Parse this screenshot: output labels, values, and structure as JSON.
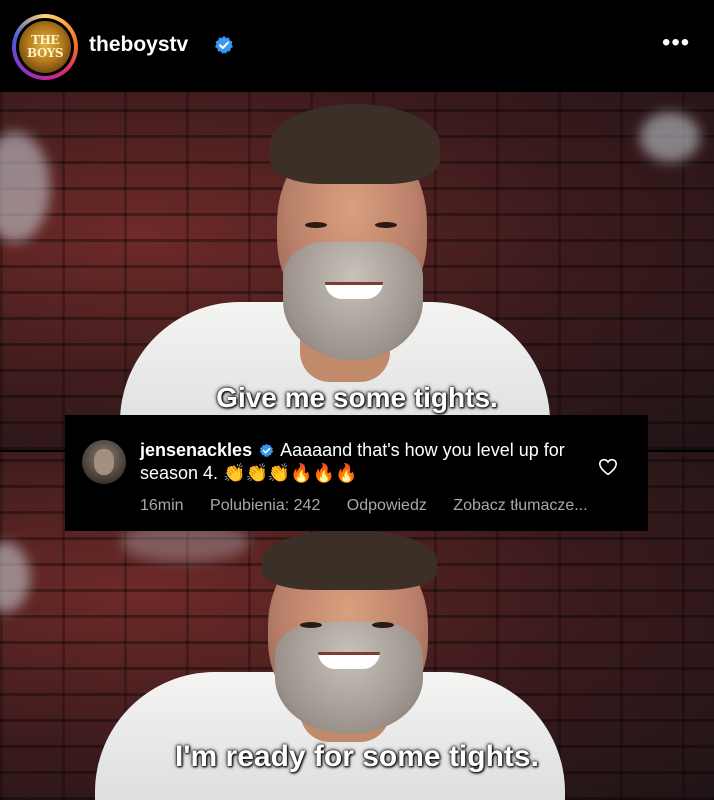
{
  "header": {
    "username": "theboystv",
    "avatar_label": "THE BOYS",
    "more_label": "•••"
  },
  "frames": [
    {
      "caption": "Give me some tights."
    },
    {
      "caption": "I'm ready for some tights."
    }
  ],
  "comment": {
    "username": "jensenackles",
    "text": "Aaaaand that's how you level up for season 4. 👏👏👏🔥🔥🔥",
    "time": "16min",
    "likes": "Polubienia: 242",
    "reply": "Odpowiedz",
    "translate": "Zobacz tłumacze..."
  },
  "colors": {
    "verified": "#3897f0",
    "background": "#000000",
    "meta_text": "#a8a8a8"
  }
}
